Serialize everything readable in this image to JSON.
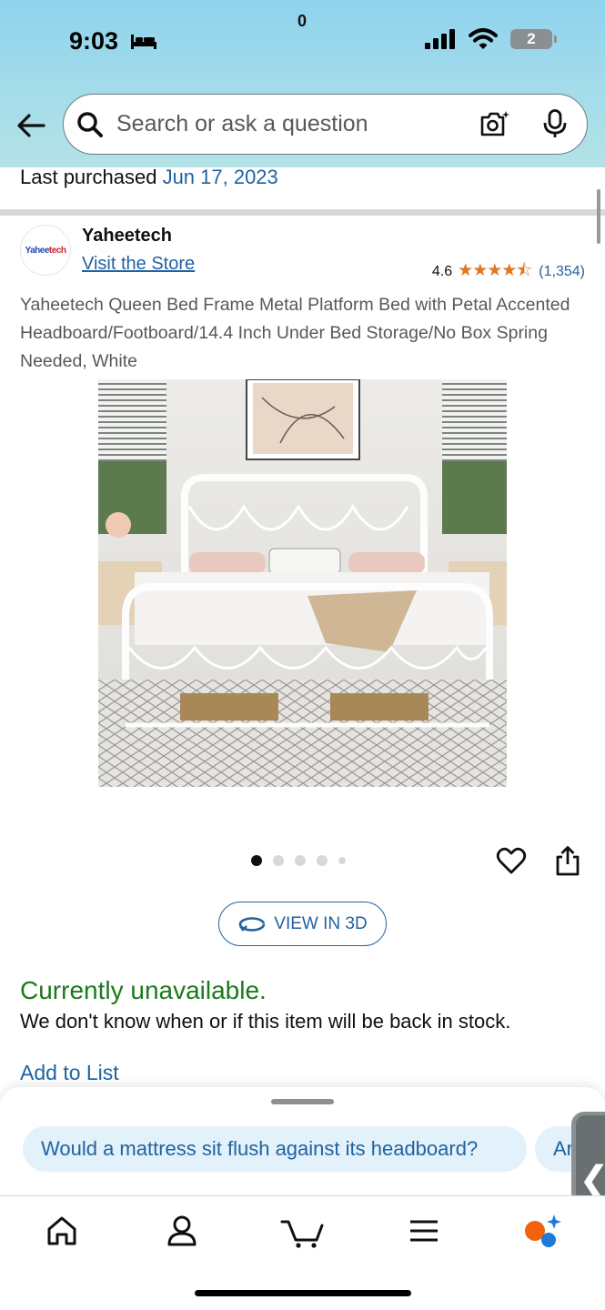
{
  "status_bar": {
    "time": "9:03",
    "battery": "2"
  },
  "search": {
    "placeholder": "Search or ask a question"
  },
  "purchase": {
    "label": "Last purchased",
    "date": "Jun 17, 2023"
  },
  "brand": {
    "logo_text_a": "Yahee",
    "logo_text_b": "tech",
    "name": "Yaheetech",
    "store_link": "Visit the Store"
  },
  "rating": {
    "value": "4.6",
    "stars": "★★★★⯪",
    "count": "(1,354)"
  },
  "product": {
    "title": "Yaheetech Queen Bed Frame Metal Platform Bed with Petal Accented Headboard/Footboard/14.4 Inch Under Bed Storage/No Box Spring Needed, White"
  },
  "gallery": {
    "total_images": 5,
    "active_index": 0
  },
  "view3d": {
    "label": "VIEW IN 3D"
  },
  "availability": {
    "status": "Currently unavailable.",
    "message": "We don't know when or if this item will be back in stock."
  },
  "add_to_list": "Add to List",
  "suggestions": [
    "Would a mattress sit flush against its headboard?",
    "Ar"
  ],
  "side_tab": {
    "glyph": "❮"
  },
  "nav": {
    "cart_count": "0"
  },
  "colors": {
    "link": "#2162a1",
    "unavailable": "#1c7a1c",
    "star": "#de7921",
    "chip_bg": "#e2f1fa"
  }
}
